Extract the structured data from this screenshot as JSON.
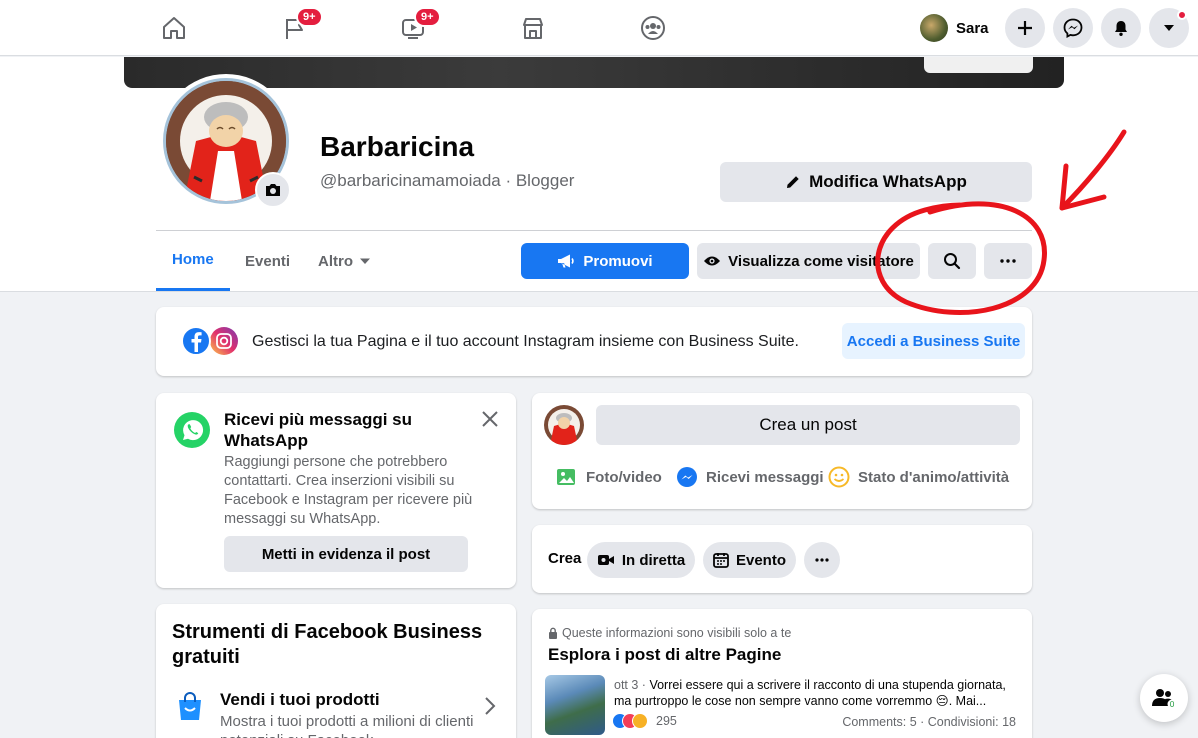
{
  "nav": {
    "pages_badge": "9+",
    "watch_badge": "9+",
    "user_name": "Sara"
  },
  "header": {
    "page_name": "Barbaricina",
    "page_handle": "@barbaricinamamoiada · Blogger",
    "whatsapp_button": "Modifica WhatsApp",
    "tabs": [
      {
        "label": "Home"
      },
      {
        "label": "Eventi"
      },
      {
        "label": "Altro"
      }
    ],
    "promote_button": "Promuovi",
    "view_as_visitor_button": "Visualizza come visitatore"
  },
  "business_suite": {
    "text": "Gestisci la tua Pagina e il tuo account Instagram insieme con Business Suite.",
    "button": "Accedi a Business Suite"
  },
  "whatsapp_card": {
    "title": "Ricevi più messaggi su WhatsApp",
    "description": "Raggiungi persone che potrebbero contattarti. Crea inserzioni visibili su Facebook e Instagram per ricevere più messaggi su WhatsApp.",
    "button": "Metti in evidenza il post"
  },
  "composer": {
    "create_post": "Crea un post",
    "actions": [
      "Foto/video",
      "Ricevi messaggi",
      "Stato d'animo/attività"
    ]
  },
  "create_bar": {
    "label": "Crea",
    "live": "In diretta",
    "event": "Evento"
  },
  "tools_card": {
    "title": "Strumenti di Facebook Business gratuiti",
    "item_title": "Vendi i tuoi prodotti",
    "item_desc": "Mostra i tuoi prodotti a milioni di clienti potenziali su Facebook"
  },
  "explore_card": {
    "privacy_note": "Queste informazioni sono visibili solo a te",
    "title": "Esplora i post di altre Pagine",
    "post_date": "ott 3 ·",
    "post_text": "Vorrei essere qui a scrivere il racconto di una stupenda giornata, ma purtroppo le cose non sempre vanno come vorremmo 😔. Mai...",
    "reactions": "295",
    "counts": "Comments: 5 · Condivisioni: 18"
  },
  "float_badge": "0",
  "colors": {
    "brand_blue": "#1877f2",
    "badge_red": "#e41e3f",
    "annotation_red": "#e8141b"
  }
}
